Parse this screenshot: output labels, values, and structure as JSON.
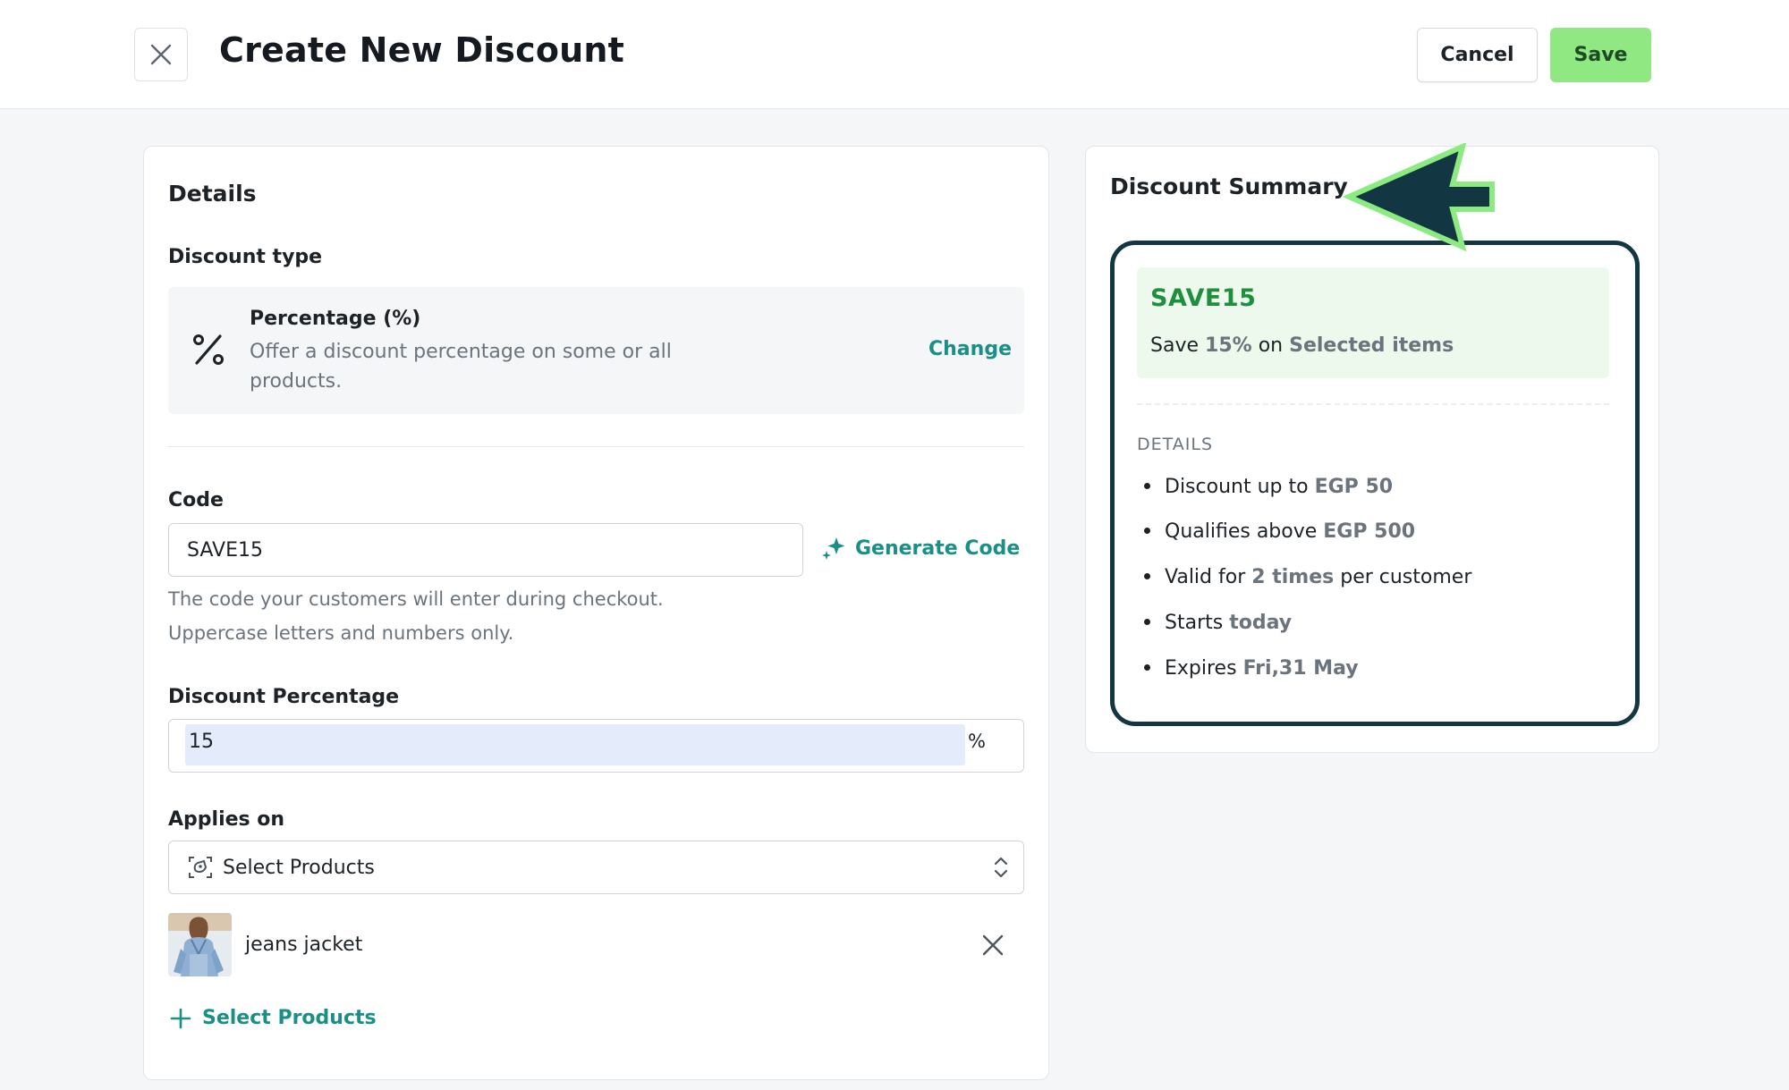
{
  "header": {
    "title": "Create New Discount",
    "cancel_label": "Cancel",
    "save_label": "Save"
  },
  "details": {
    "section_title": "Details",
    "discount_type_label": "Discount type",
    "type_title": "Percentage (%)",
    "type_description": "Offer a discount percentage on some or all products.",
    "change_label": "Change",
    "code_label": "Code",
    "code_value": "SAVE15",
    "generate_code_label": "Generate Code",
    "code_help_1": "The code your customers will enter during checkout.",
    "code_help_2": "Uppercase letters and numbers only.",
    "percentage_label": "Discount Percentage",
    "percentage_value": "15",
    "percentage_suffix": "%",
    "applies_on_label": "Applies on",
    "applies_on_value": "Select Products",
    "product_name": "jeans jacket",
    "add_products_label": "Select Products"
  },
  "summary": {
    "title": "Discount Summary",
    "code": "SAVE15",
    "line_save": "Save",
    "line_pct": "15%",
    "line_on": "on",
    "line_target": "Selected items",
    "details_heading": "DETAILS",
    "items": [
      {
        "text": "Discount up to",
        "value": "EGP 50",
        "tail": ""
      },
      {
        "text": "Qualifies above",
        "value": "EGP 500",
        "tail": ""
      },
      {
        "text": "Valid for",
        "value": "2 times",
        "tail": "per customer"
      },
      {
        "text": "Starts",
        "value": "today",
        "tail": ""
      },
      {
        "text": "Expires",
        "value": "Fri,31 May",
        "tail": ""
      }
    ]
  },
  "colors": {
    "accent_teal": "#1a8f86",
    "save_button": "#90e883",
    "summary_code": "#1f8f3e",
    "highlight_frame": "#123642"
  },
  "icons": [
    "close-icon",
    "percent-icon",
    "sparkle-icon",
    "product-select-icon",
    "chevron-updown-icon",
    "remove-icon",
    "plus-icon",
    "arrow-pointer-icon"
  ]
}
